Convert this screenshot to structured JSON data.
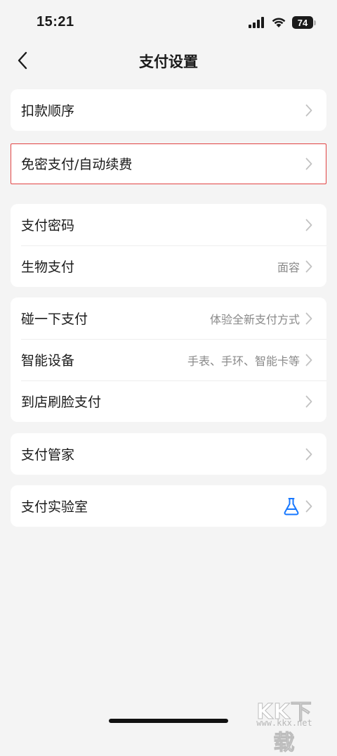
{
  "status_bar": {
    "time": "15:21",
    "battery": "74",
    "icons": [
      "signal-icon",
      "wifi-icon",
      "battery-icon"
    ]
  },
  "nav": {
    "title": "支付设置",
    "back_icon": "chevron-left-icon"
  },
  "groups": [
    {
      "highlight": false,
      "items": [
        {
          "label": "扣款顺序",
          "value": ""
        }
      ]
    },
    {
      "highlight": true,
      "items": [
        {
          "label": "免密支付/自动续费",
          "value": ""
        }
      ]
    },
    {
      "highlight": false,
      "items": [
        {
          "label": "支付密码",
          "value": ""
        },
        {
          "label": "生物支付",
          "value": "面容"
        }
      ]
    },
    {
      "highlight": false,
      "items": [
        {
          "label": "碰一下支付",
          "value": "体验全新支付方式"
        },
        {
          "label": "智能设备",
          "value": "手表、手环、智能卡等"
        },
        {
          "label": "到店刷脸支付",
          "value": ""
        }
      ]
    },
    {
      "highlight": false,
      "items": [
        {
          "label": "支付管家",
          "value": ""
        }
      ]
    },
    {
      "highlight": false,
      "items": [
        {
          "label": "支付实验室",
          "value": "",
          "icon": "flask-icon"
        }
      ]
    }
  ],
  "colors": {
    "background": "#f4f4f4",
    "card": "#ffffff",
    "highlight_border": "#e14343",
    "flask_icon": "#1677ff",
    "secondary_text": "#8a8a8a",
    "chevron": "#c2c2c2"
  },
  "watermark": {
    "text": "KK下载",
    "url": "www.kkx.net"
  }
}
